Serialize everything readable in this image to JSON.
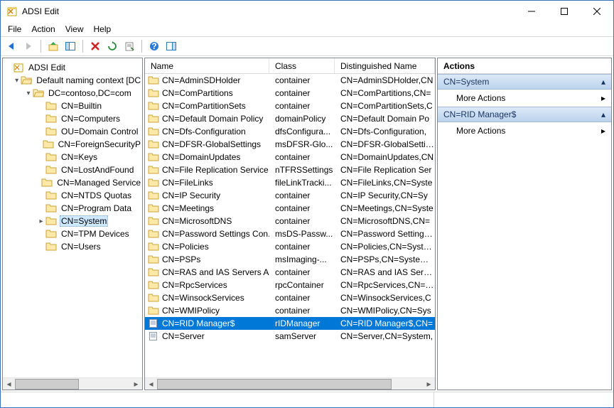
{
  "window": {
    "title": "ADSI Edit"
  },
  "menu": [
    "File",
    "Action",
    "View",
    "Help"
  ],
  "tree": {
    "root": "ADSI Edit",
    "context": "Default naming context [DC",
    "dc": "DC=contoso,DC=com",
    "children": [
      "CN=Builtin",
      "CN=Computers",
      "OU=Domain Control",
      "CN=ForeignSecurityP",
      "CN=Keys",
      "CN=LostAndFound",
      "CN=Managed Service",
      "CN=NTDS Quotas",
      "CN=Program Data",
      "CN=System",
      "CN=TPM Devices",
      "CN=Users"
    ],
    "selected": "CN=System"
  },
  "list": {
    "columns": [
      "Name",
      "Class",
      "Distinguished Name"
    ],
    "rows": [
      {
        "name": "CN=AdminSDHolder",
        "class": "container",
        "dn": "CN=AdminSDHolder,CN"
      },
      {
        "name": "CN=ComPartitions",
        "class": "container",
        "dn": "CN=ComPartitions,CN="
      },
      {
        "name": "CN=ComPartitionSets",
        "class": "container",
        "dn": "CN=ComPartitionSets,C"
      },
      {
        "name": "CN=Default Domain Policy",
        "class": "domainPolicy",
        "dn": "CN=Default Domain Po"
      },
      {
        "name": "CN=Dfs-Configuration",
        "class": "dfsConfigura...",
        "dn": "CN=Dfs-Configuration,"
      },
      {
        "name": "CN=DFSR-GlobalSettings",
        "class": "msDFSR-Glo...",
        "dn": "CN=DFSR-GlobalSetting"
      },
      {
        "name": "CN=DomainUpdates",
        "class": "container",
        "dn": "CN=DomainUpdates,CN"
      },
      {
        "name": "CN=File Replication Service",
        "class": "nTFRSSettings",
        "dn": "CN=File Replication Ser"
      },
      {
        "name": "CN=FileLinks",
        "class": "fileLinkTracki...",
        "dn": "CN=FileLinks,CN=Syste"
      },
      {
        "name": "CN=IP Security",
        "class": "container",
        "dn": "CN=IP Security,CN=Sy"
      },
      {
        "name": "CN=Meetings",
        "class": "container",
        "dn": "CN=Meetings,CN=Syste"
      },
      {
        "name": "CN=MicrosoftDNS",
        "class": "container",
        "dn": "CN=MicrosoftDNS,CN="
      },
      {
        "name": "CN=Password Settings Con...",
        "class": "msDS-Passw...",
        "dn": "CN=Password Settings C"
      },
      {
        "name": "CN=Policies",
        "class": "container",
        "dn": "CN=Policies,CN=System"
      },
      {
        "name": "CN=PSPs",
        "class": "msImaging-...",
        "dn": "CN=PSPs,CN=System,D"
      },
      {
        "name": "CN=RAS and IAS Servers Ac...",
        "class": "container",
        "dn": "CN=RAS and IAS Servers"
      },
      {
        "name": "CN=RpcServices",
        "class": "rpcContainer",
        "dn": "CN=RpcServices,CN=Sy"
      },
      {
        "name": "CN=WinsockServices",
        "class": "container",
        "dn": "CN=WinsockServices,C"
      },
      {
        "name": "CN=WMIPolicy",
        "class": "container",
        "dn": "CN=WMIPolicy,CN=Sys"
      },
      {
        "name": "CN=RID Manager$",
        "class": "rIDManager",
        "dn": "CN=RID Manager$,CN=",
        "selected": true,
        "icon": "object"
      },
      {
        "name": "CN=Server",
        "class": "samServer",
        "dn": "CN=Server,CN=System,",
        "icon": "object"
      }
    ]
  },
  "actions": {
    "header": "Actions",
    "sections": [
      {
        "title": "CN=System",
        "items": [
          "More Actions"
        ]
      },
      {
        "title": "CN=RID Manager$",
        "items": [
          "More Actions"
        ]
      }
    ]
  }
}
